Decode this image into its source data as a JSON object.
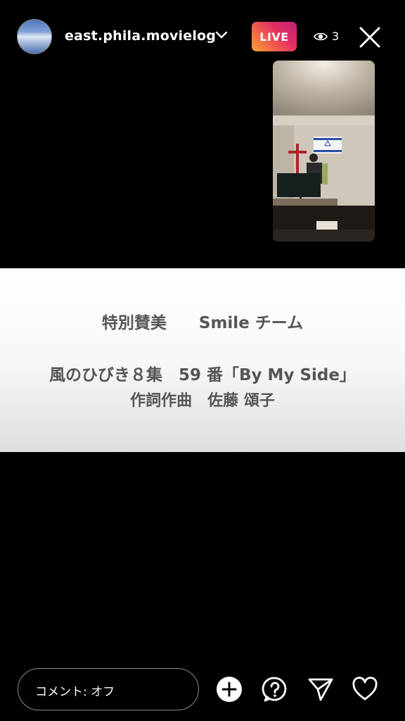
{
  "header": {
    "username": "east.phila.movielog",
    "live_label": "LIVE",
    "viewer_count": "3"
  },
  "title_card": {
    "line1": "特別賛美　　Smile チーム",
    "line2": "風のひびき８集　59 番「By My Side」",
    "line3": "作詞作曲　佐藤 頌子"
  },
  "bottom": {
    "comment_placeholder": "コメント: オフ"
  },
  "icons": {
    "avatar": "avatar-image",
    "username_dropdown": "chevron-down-icon",
    "viewers": "eye-icon",
    "close": "close-icon",
    "add": "plus-circle-icon",
    "question": "question-bubble-icon",
    "send": "paper-plane-icon",
    "like": "heart-icon"
  },
  "colors": {
    "background": "#000000",
    "live_gradient": [
      "#f7a534",
      "#c2217c"
    ],
    "title_card_text": "#555555"
  }
}
